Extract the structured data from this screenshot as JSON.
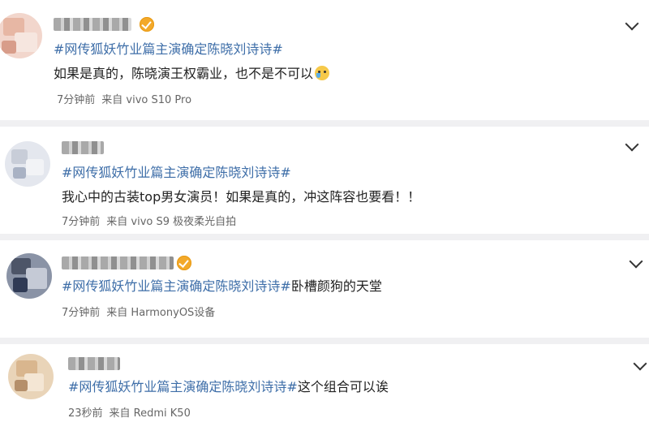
{
  "posts": [
    {
      "hashtag": "#网传狐妖竹业篇主演确定陈晓刘诗诗#",
      "text": "如果是真的，陈晓演王权霸业，也不是不可以",
      "time": "7分钟前",
      "source": "来自 vivo S10 Pro"
    },
    {
      "hashtag": "#网传狐妖竹业篇主演确定陈晓刘诗诗#",
      "text": "我心中的古装top男女演员！如果是真的，冲这阵容也要看！！",
      "time": "7分钟前",
      "source": "来自 vivo S9 极夜柔光自拍"
    },
    {
      "hashtag": "#网传狐妖竹业篇主演确定陈晓刘诗诗#",
      "text": "卧槽颜狗的天堂",
      "time": "7分钟前",
      "source": "来自 HarmonyOS设备"
    },
    {
      "hashtag": "#网传狐妖竹业篇主演确定陈晓刘诗诗#",
      "text": "这个组合可以诶",
      "time": "23秒前",
      "source": "来自 Redmi K50"
    }
  ],
  "icons": {
    "verified": "verified-badge-icon",
    "expand": "chevron-down-icon",
    "emoji": "crying-laugh-emoji-icon"
  },
  "colors": {
    "hashtag": "#3e6ea8",
    "meta": "#666666",
    "verified": "#f3a92a",
    "separator": "#f0f0f2"
  }
}
